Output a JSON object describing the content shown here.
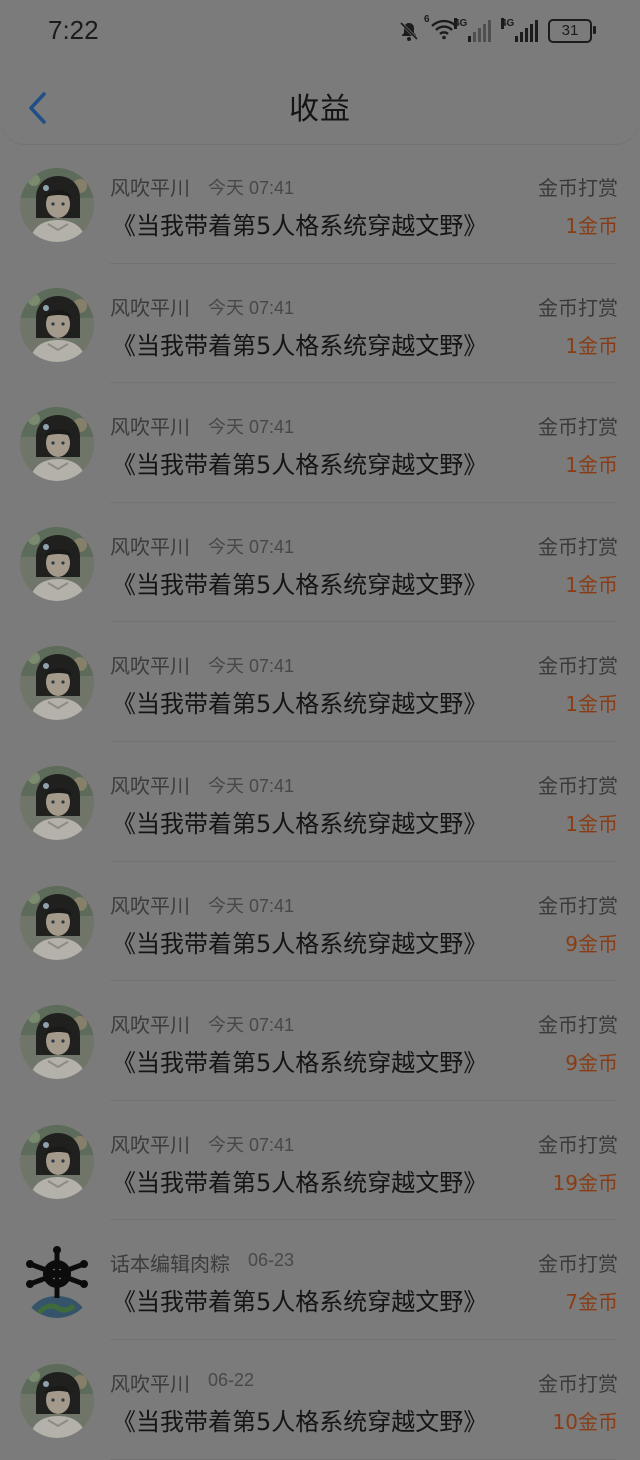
{
  "status": {
    "time": "7:22",
    "battery": "31",
    "signal_tag": "4G",
    "wifi_tag": "6"
  },
  "header": {
    "title": "收益"
  },
  "rows": [
    {
      "name": "风吹平川",
      "date": "今天 07:41",
      "book": "《当我带着第5人格系统穿越文野》",
      "type": "金币打赏",
      "amount": "1金币",
      "avatar": "girl"
    },
    {
      "name": "风吹平川",
      "date": "今天 07:41",
      "book": "《当我带着第5人格系统穿越文野》",
      "type": "金币打赏",
      "amount": "1金币",
      "avatar": "girl"
    },
    {
      "name": "风吹平川",
      "date": "今天 07:41",
      "book": "《当我带着第5人格系统穿越文野》",
      "type": "金币打赏",
      "amount": "1金币",
      "avatar": "girl"
    },
    {
      "name": "风吹平川",
      "date": "今天 07:41",
      "book": "《当我带着第5人格系统穿越文野》",
      "type": "金币打赏",
      "amount": "1金币",
      "avatar": "girl"
    },
    {
      "name": "风吹平川",
      "date": "今天 07:41",
      "book": "《当我带着第5人格系统穿越文野》",
      "type": "金币打赏",
      "amount": "1金币",
      "avatar": "girl"
    },
    {
      "name": "风吹平川",
      "date": "今天 07:41",
      "book": "《当我带着第5人格系统穿越文野》",
      "type": "金币打赏",
      "amount": "1金币",
      "avatar": "girl"
    },
    {
      "name": "风吹平川",
      "date": "今天 07:41",
      "book": "《当我带着第5人格系统穿越文野》",
      "type": "金币打赏",
      "amount": "9金币",
      "avatar": "girl"
    },
    {
      "name": "风吹平川",
      "date": "今天 07:41",
      "book": "《当我带着第5人格系统穿越文野》",
      "type": "金币打赏",
      "amount": "9金币",
      "avatar": "girl"
    },
    {
      "name": "风吹平川",
      "date": "今天 07:41",
      "book": "《当我带着第5人格系统穿越文野》",
      "type": "金币打赏",
      "amount": "19金币",
      "avatar": "girl"
    },
    {
      "name": "话本编辑肉粽",
      "date": "06-23",
      "book": "《当我带着第5人格系统穿越文野》",
      "type": "金币打赏",
      "amount": "7金币",
      "avatar": "editor"
    },
    {
      "name": "风吹平川",
      "date": "06-22",
      "book": "《当我带着第5人格系统穿越文野》",
      "type": "金币打赏",
      "amount": "10金币",
      "avatar": "girl"
    }
  ]
}
